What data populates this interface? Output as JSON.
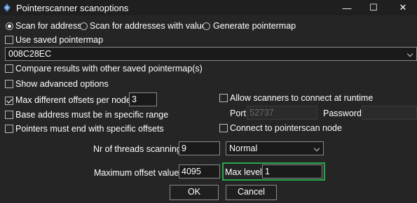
{
  "window": {
    "title": "Pointerscanner scanoptions",
    "controls": {
      "minimize": "—",
      "maximize": "☐",
      "close": "✕"
    }
  },
  "scan_mode": {
    "options": [
      "Scan for address",
      "Scan for addresses with value",
      "Generate pointermap"
    ],
    "selected": "Scan for address"
  },
  "use_saved_pointermap": {
    "label": "Use saved pointermap",
    "checked": false
  },
  "address_combo": {
    "value": "008C28EC"
  },
  "compare_results": {
    "label": "Compare results with other saved pointermap(s)",
    "checked": false
  },
  "show_advanced": {
    "label": "Show advanced options",
    "checked": false
  },
  "max_offsets": {
    "label": "Max different offsets per node:",
    "checked": true,
    "value": "3"
  },
  "base_address_range": {
    "label": "Base address must be in specific range",
    "checked": false
  },
  "pointers_end_offsets": {
    "label": "Pointers must end with specific offsets",
    "checked": false
  },
  "allow_scanners": {
    "label": "Allow scanners to connect at runtime",
    "checked": false
  },
  "port": {
    "label": "Port:",
    "value": "52737"
  },
  "password": {
    "label": "Password",
    "value": ""
  },
  "connect_pointerscan": {
    "label": "Connect to pointerscan node",
    "checked": false
  },
  "threads": {
    "label": "Nr of threads scanning:",
    "value": "9",
    "priority": "Normal"
  },
  "max_offset_value": {
    "label": "Maximum offset value:",
    "value": "4095"
  },
  "max_level": {
    "label": "Max level",
    "value": "1"
  },
  "buttons": {
    "ok": "OK",
    "cancel": "Cancel"
  },
  "colors": {
    "background": "#252525",
    "highlight": "#29a84a",
    "input_bg": "#1a1a1a"
  }
}
